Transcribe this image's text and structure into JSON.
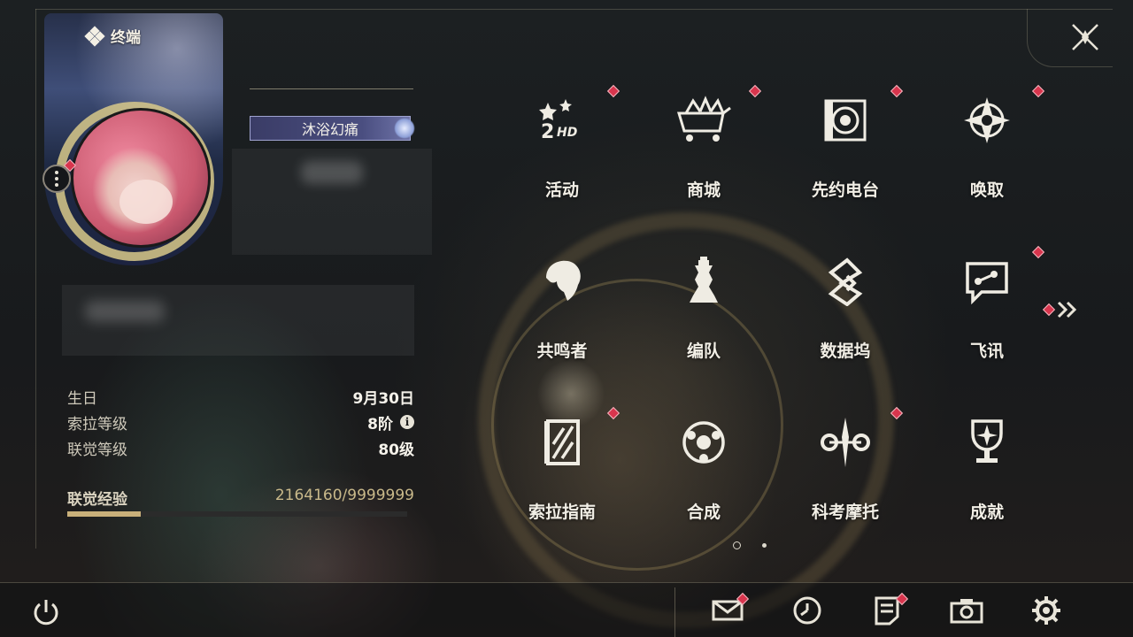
{
  "header": {
    "title": "终端",
    "title_icon": "diamond-cluster-icon",
    "close_icon": "close-x-icon"
  },
  "profile": {
    "badge": "沐浴幻痛",
    "stats": [
      {
        "label": "生日",
        "value": "9月30日"
      },
      {
        "label": "索拉等级",
        "value": "8阶",
        "info": "i"
      },
      {
        "label": "联觉等级",
        "value": "80级"
      }
    ],
    "exp": {
      "label": "联觉经验",
      "value": "2164160/9999999",
      "progress": 0.2164
    }
  },
  "menu": {
    "rows": [
      [
        {
          "label": "活动",
          "icon": "2hd-stars-icon",
          "notify": true
        },
        {
          "label": "商城",
          "icon": "shop-cart-icon",
          "notify": true
        },
        {
          "label": "先约电台",
          "icon": "radio-speaker-icon",
          "notify": true
        },
        {
          "label": "唤取",
          "icon": "compass-star-icon",
          "notify": true
        }
      ],
      [
        {
          "label": "共鸣者",
          "icon": "resonator-head-icon",
          "notify": false
        },
        {
          "label": "编队",
          "icon": "chess-piece-icon",
          "notify": false
        },
        {
          "label": "数据坞",
          "icon": "data-dock-icon",
          "notify": false
        },
        {
          "label": "飞讯",
          "icon": "chat-bubble-icon",
          "notify": true
        }
      ],
      [
        {
          "label": "索拉指南",
          "icon": "guide-book-icon",
          "notify": true
        },
        {
          "label": "合成",
          "icon": "synthesis-orb-icon",
          "notify": false
        },
        {
          "label": "科考摩托",
          "icon": "motorcycle-icon",
          "notify": true
        },
        {
          "label": "成就",
          "icon": "trophy-icon",
          "notify": false
        }
      ]
    ],
    "next_page_icon": "double-chevron-right-icon",
    "pages": {
      "current": 1,
      "total": 2
    }
  },
  "bottom_bar": {
    "items": [
      {
        "name": "power",
        "icon": "power-icon"
      },
      {
        "name": "mail",
        "icon": "mail-icon",
        "notify": true
      },
      {
        "name": "clock",
        "icon": "clock-icon"
      },
      {
        "name": "notes",
        "icon": "notes-icon",
        "notify": true
      },
      {
        "name": "camera",
        "icon": "camera-icon"
      },
      {
        "name": "settings",
        "icon": "gear-icon"
      }
    ]
  },
  "colors": {
    "accent": "#c9b07a",
    "notify": "#d8354d",
    "text": "#f2efe6",
    "badge": "#4a4e80"
  }
}
